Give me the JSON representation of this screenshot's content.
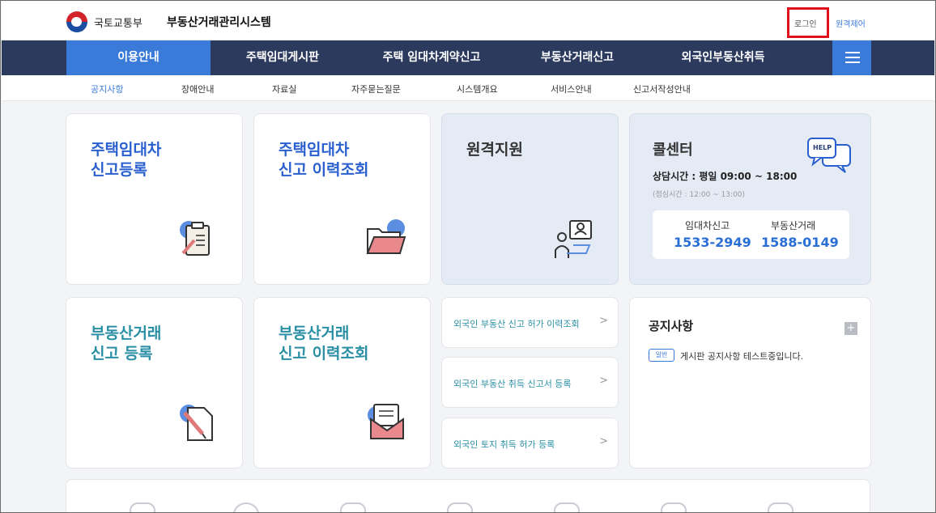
{
  "header": {
    "ministry": "국토교통부",
    "system_title": "부동산거래관리시스템",
    "login": "로그인",
    "remote": "원격제어"
  },
  "main_nav": [
    {
      "label": "이용안내",
      "active": true
    },
    {
      "label": "주택임대게시판",
      "active": false
    },
    {
      "label": "주택 임대차계약신고",
      "active": false
    },
    {
      "label": "부동산거래신고",
      "active": false
    },
    {
      "label": "외국인부동산취득",
      "active": false
    }
  ],
  "sub_nav": [
    {
      "label": "공지사항",
      "active": true
    },
    {
      "label": "장애안내",
      "active": false
    },
    {
      "label": "자료실",
      "active": false
    },
    {
      "label": "자주묻는질문",
      "active": false
    },
    {
      "label": "시스템개요",
      "active": false
    },
    {
      "label": "서비스안내",
      "active": false
    },
    {
      "label": "신고서작성안내",
      "active": false
    }
  ],
  "cards": {
    "lease_register": "주택임대차\n신고등록",
    "lease_history": "주택임대차\n신고 이력조회",
    "remote_support": "원격지원",
    "trade_register": "부동산거래\n신고 등록",
    "trade_history": "부동산거래\n신고 이력조회"
  },
  "call_center": {
    "title": "콜센터",
    "hours": "상담시간 : 평일 09:00 ~ 18:00",
    "lunch": "(점심시간 : 12:00 ~ 13:00)",
    "help_bubble": "HELP",
    "lease_label": "임대차신고",
    "lease_phone": "1533-2949",
    "trade_label": "부동산거래",
    "trade_phone": "1588-0149"
  },
  "foreign": [
    {
      "label": "외국인 부동산 신고 허가 이력조회"
    },
    {
      "label": "외국인 부동산 취득 신고서 등록"
    },
    {
      "label": "외국인 토지 취득 허가 등록"
    }
  ],
  "notice": {
    "title": "공지사항",
    "plus": "+",
    "items": [
      {
        "badge": "일반",
        "text": "게시판 공지사항 테스트중입니다."
      }
    ]
  },
  "colors": {
    "nav_bg": "#2c3a5e",
    "accent": "#3a7ad8",
    "teal": "#2a8fa5",
    "highlight_box": "#e0111b"
  }
}
